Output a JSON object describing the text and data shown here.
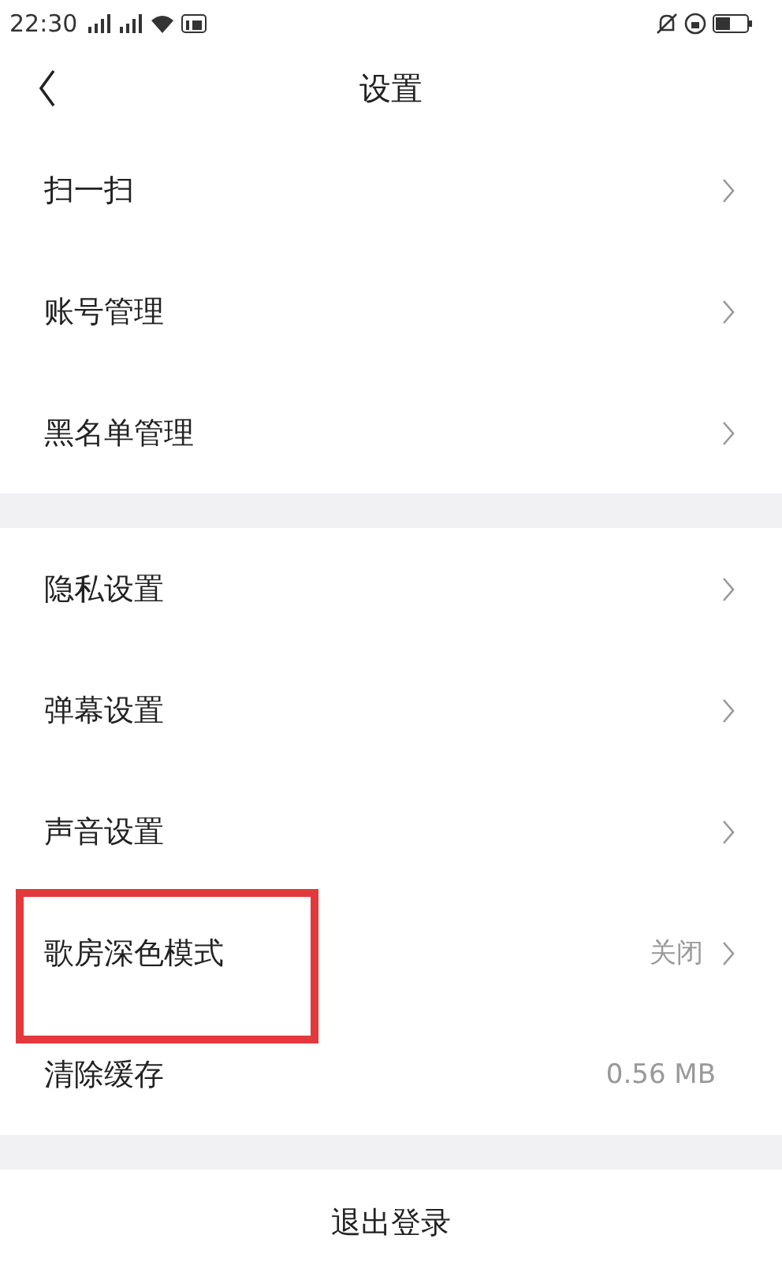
{
  "status_bar": {
    "time": "22:30"
  },
  "header": {
    "title": "设置"
  },
  "groups": [
    {
      "items": [
        {
          "label": "扫一扫",
          "chevron": true,
          "highlighted": false
        },
        {
          "label": "账号管理",
          "chevron": true,
          "highlighted": false
        },
        {
          "label": "黑名单管理",
          "chevron": true,
          "highlighted": false
        }
      ]
    },
    {
      "items": [
        {
          "label": "隐私设置",
          "chevron": true,
          "highlighted": false
        },
        {
          "label": "弹幕设置",
          "chevron": true,
          "highlighted": false
        },
        {
          "label": "声音设置",
          "chevron": true,
          "highlighted": false
        },
        {
          "label": "歌房深色模式",
          "value": "关闭",
          "chevron": true,
          "highlighted": true
        },
        {
          "label": "清除缓存",
          "value": "0.56 MB",
          "chevron": false,
          "highlighted": false
        }
      ]
    }
  ],
  "logout": {
    "label": "退出登录"
  }
}
